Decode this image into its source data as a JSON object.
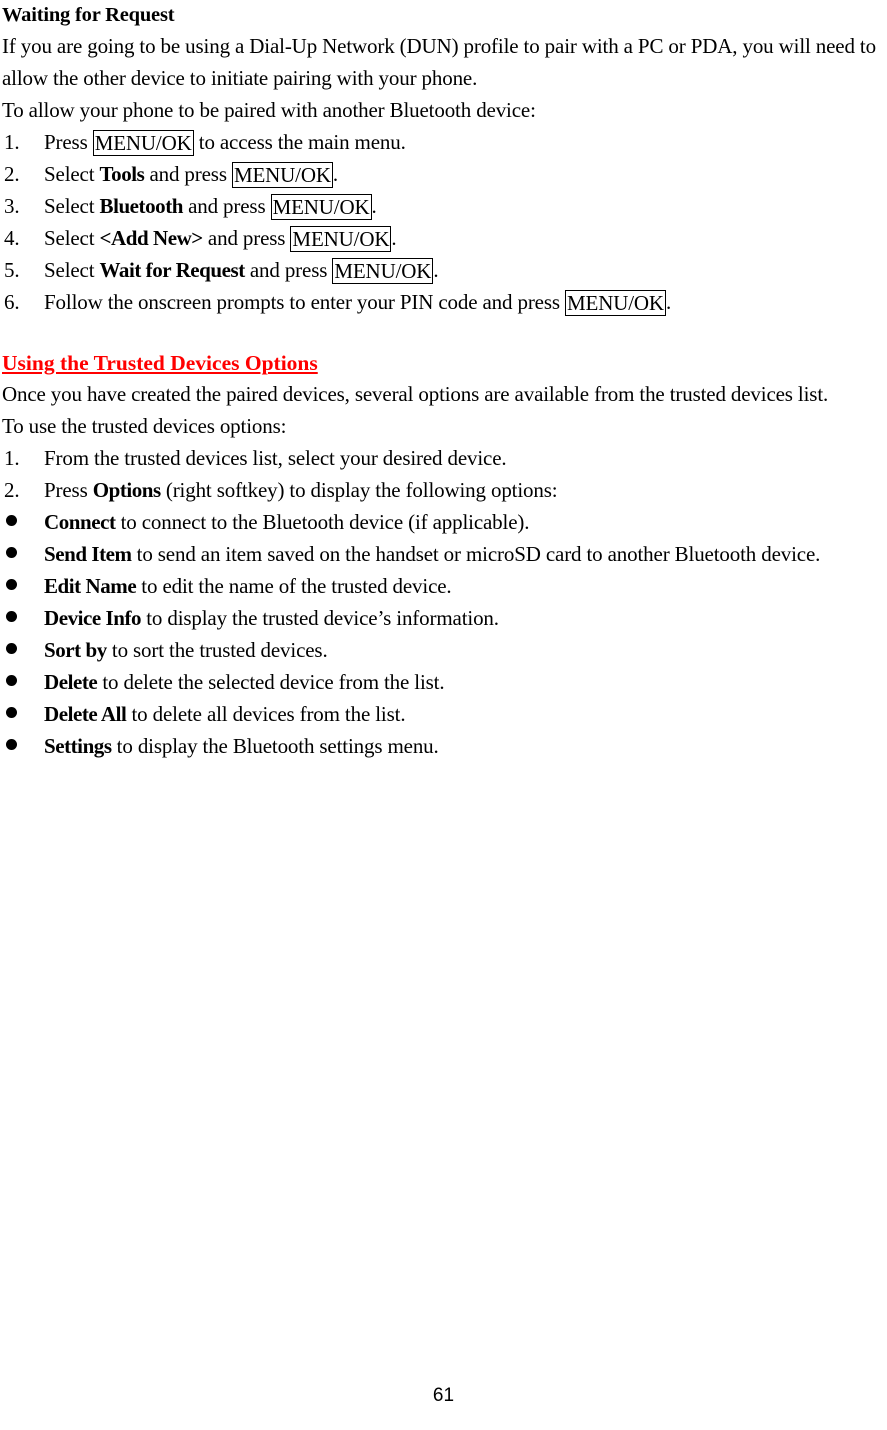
{
  "document": {
    "page_number": "61",
    "heading_color_red": "#FF0000",
    "text_color": "#000000"
  },
  "section1": {
    "heading": "Waiting for Request",
    "intro_paragraph": "If you are going to be using a Dial-Up Network (DUN) profile to pair with a PC or PDA, you will need to allow the other device to initiate pairing with your phone.",
    "lead_in": "To allow your phone to be paired with another Bluetooth device:",
    "steps": [
      {
        "number": "1.",
        "pre": "Press ",
        "key": "MENU/OK",
        "post": " to access the main menu."
      },
      {
        "number": "2.",
        "pre": "Select ",
        "bold": "Tools",
        "mid": " and press ",
        "key": "MENU/OK",
        "post": "."
      },
      {
        "number": "3.",
        "pre": "Select ",
        "bold": "Bluetooth",
        "mid": " and press ",
        "key": "MENU/OK",
        "post": "."
      },
      {
        "number": "4.",
        "pre": "Select ",
        "bold": "<Add New>",
        "mid": " and press ",
        "key": "MENU/OK",
        "post": "."
      },
      {
        "number": "5.",
        "pre": "Select ",
        "bold": "Wait for Request",
        "mid": " and press ",
        "key": "MENU/OK",
        "post": "."
      },
      {
        "number": "6.",
        "pre": "Follow the onscreen prompts to enter your PIN code and press ",
        "key": "MENU/OK",
        "post": "."
      }
    ]
  },
  "section2": {
    "heading": "Using the Trusted Devices Options",
    "intro_paragraph": "Once you have created the paired devices, several options are available from the trusted devices list.",
    "lead_in": "To use the trusted devices options:",
    "steps": [
      {
        "number": "1.",
        "pre": "From the trusted devices list, select your desired device."
      },
      {
        "number": "2.",
        "pre": "Press ",
        "bold": "Options",
        "post": " (right softkey) to display the following options:"
      }
    ],
    "options": [
      {
        "term": "Connect",
        "description": " to connect to the Bluetooth device (if applicable)."
      },
      {
        "term": "Send Item",
        "description": " to send an item saved on the handset or microSD card to another Bluetooth device."
      },
      {
        "term": "Edit Name",
        "description": " to edit the name of the trusted device."
      },
      {
        "term": "Device Info",
        "description": " to display the trusted device’s information."
      },
      {
        "term": "Sort by",
        "description": " to sort the trusted devices."
      },
      {
        "term": "Delete",
        "description": " to delete the selected device from the list."
      },
      {
        "term": "Delete All",
        "description": " to delete all devices from the list."
      },
      {
        "term": "Settings",
        "description": " to display the Bluetooth settings menu."
      }
    ]
  }
}
